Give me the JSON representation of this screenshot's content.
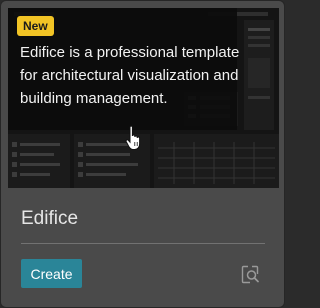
{
  "card": {
    "badge": "New",
    "description": "Edifice is a professional template for architectural visualization and building management.",
    "title": "Edifice",
    "create_label": "Create",
    "preview_icon": "preview-search-icon"
  },
  "colors": {
    "badge": "#f2c425",
    "create_button": "#2a8598",
    "card_background": "#4a4a4a"
  }
}
